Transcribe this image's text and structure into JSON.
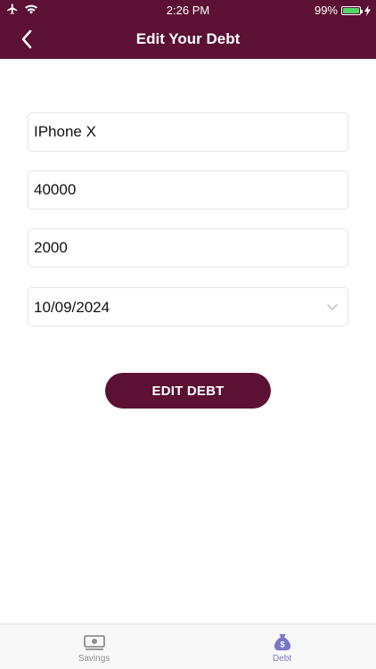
{
  "status_bar": {
    "time": "2:26 PM",
    "battery_percent": "99%",
    "battery_level": 0.99
  },
  "nav": {
    "title": "Edit Your Debt"
  },
  "form": {
    "item_name": "IPhone X",
    "total_amount": "40000",
    "installment_amount": "2000",
    "due_date": "10/09/2024",
    "submit_label": "EDIT DEBT"
  },
  "tabs": [
    {
      "label": "Savings",
      "icon": "money-bill-icon",
      "active": false
    },
    {
      "label": "Debt",
      "icon": "money-bag-icon",
      "active": true
    }
  ],
  "colors": {
    "brand": "#5c1034",
    "tab_active": "#7a78c4",
    "tab_inactive": "#8e8e93",
    "battery": "#4cd964"
  }
}
